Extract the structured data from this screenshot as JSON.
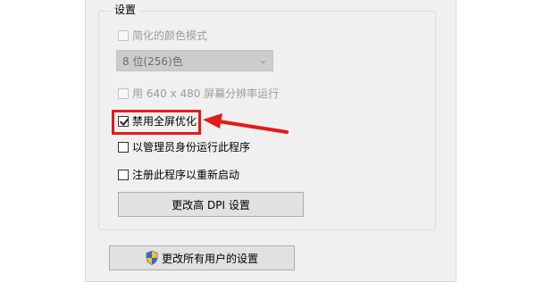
{
  "settings": {
    "group_title": "设置",
    "reduced_color_mode": {
      "label": "简化的颜色模式",
      "checked": false,
      "enabled": false
    },
    "color_depth_select": {
      "value": "8 位(256)色",
      "enabled": false
    },
    "run_640x480": {
      "label": "用 640 x 480 屏幕分辨率运行",
      "checked": false,
      "enabled": false
    },
    "disable_fullscreen_opt": {
      "label": "禁用全屏优化",
      "checked": true,
      "enabled": true
    },
    "run_as_admin": {
      "label": "以管理员身份运行此程序",
      "checked": false,
      "enabled": true
    },
    "register_restart": {
      "label": "注册此程序以重新启动",
      "checked": false,
      "enabled": true
    },
    "dpi_button_label": "更改高 DPI 设置"
  },
  "change_all_users_button": {
    "label": "更改所有用户的设置",
    "icon": "shield-icon"
  },
  "annotation": {
    "highlight_color": "#e21b1b",
    "arrow_color": "#e21b1b"
  }
}
